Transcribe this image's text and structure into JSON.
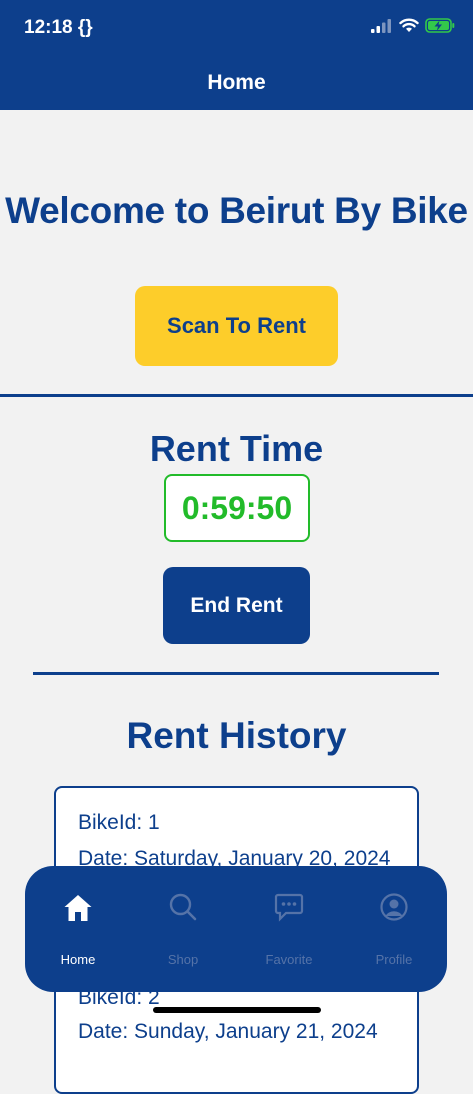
{
  "status_bar": {
    "time": "12:18 {}"
  },
  "header": {
    "title": "Home"
  },
  "welcome": "Welcome to Beirut By Bike",
  "scan_button_label": "Scan To Rent",
  "rent_time": {
    "title": "Rent Time",
    "timer": "0:59:50",
    "end_button_label": "End Rent"
  },
  "history": {
    "title": "Rent History",
    "entries": [
      {
        "bike": "BikeId: 1",
        "date": "Date: Saturday, January 20, 2024"
      },
      {
        "bike": "BikeId: 2",
        "date": "Date: Sunday, January 21, 2024"
      }
    ]
  },
  "tabbar": {
    "items": [
      {
        "label": "Home",
        "icon": "home-icon",
        "active": true
      },
      {
        "label": "Shop",
        "icon": "search-icon",
        "active": false
      },
      {
        "label": "Favorite",
        "icon": "chat-icon",
        "active": false
      },
      {
        "label": "Profile",
        "icon": "user-icon",
        "active": false
      }
    ]
  },
  "colors": {
    "primary": "#0d3f8c",
    "accent": "#fdcd2a",
    "timer": "#22bb2a",
    "background": "#f2f2f2"
  }
}
